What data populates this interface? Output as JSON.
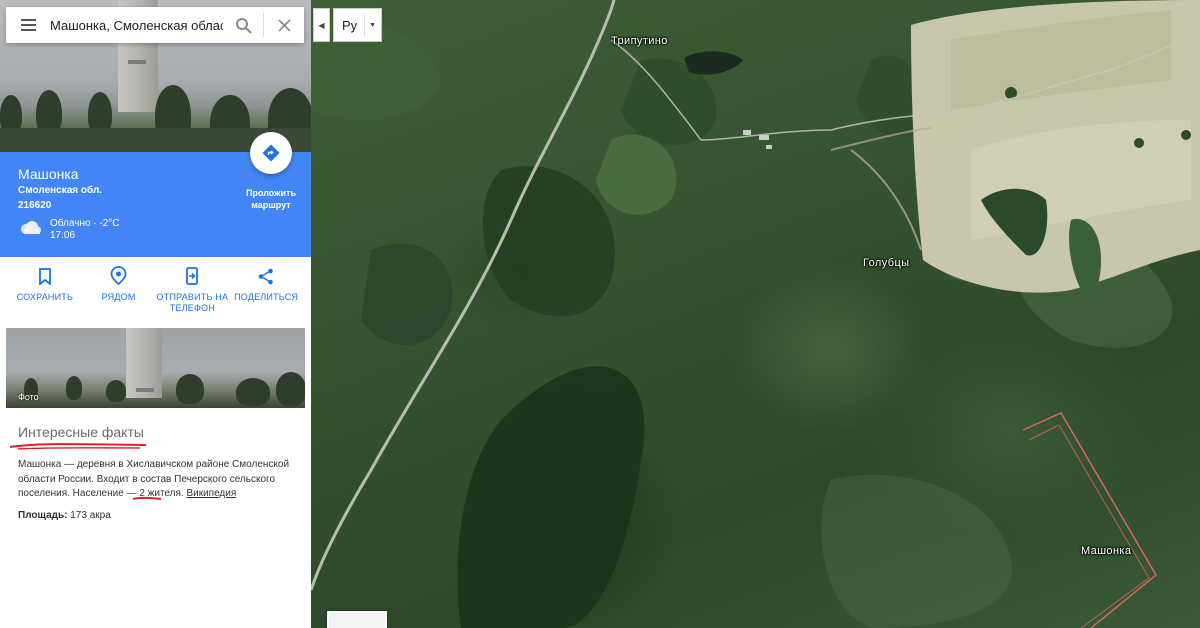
{
  "search": {
    "value": "Машонка, Смоленская область"
  },
  "language": {
    "selected": "Ру"
  },
  "place": {
    "title": "Машонка",
    "region": "Смоленская обл.",
    "postal_code": "216620",
    "weather": "Облачно · -2°C",
    "time": "17:06",
    "directions_label": "Проложить маршрут"
  },
  "actions": [
    {
      "label": "СОХРАНИТЬ",
      "icon": "bookmark-icon"
    },
    {
      "label": "РЯДОМ",
      "icon": "nearby-icon"
    },
    {
      "label": "ОТПРАВИТЬ НА ТЕЛЕФОН",
      "icon": "send-to-phone-icon"
    },
    {
      "label": "ПОДЕЛИТЬСЯ",
      "icon": "share-icon"
    }
  ],
  "photo": {
    "label": "Фото"
  },
  "facts": {
    "title": "Интересные факты",
    "text_part1": "Машонка — деревня в Хиславичском районе Смоленской области России. Входит в состав Печерского сельского поселения. Население — ",
    "population": "2 жителя",
    "text_part2": ". ",
    "source_link": "Википедия",
    "area_label": "Площадь:",
    "area_value": "173 акра"
  },
  "map": {
    "labels": {
      "triputino": "Трипутино",
      "golubtsy": "Голубцы",
      "mashonka": "Машонка"
    }
  },
  "colors": {
    "accent": "#4285f4",
    "link": "#1a73e8",
    "annotation_red": "#e0202a"
  }
}
